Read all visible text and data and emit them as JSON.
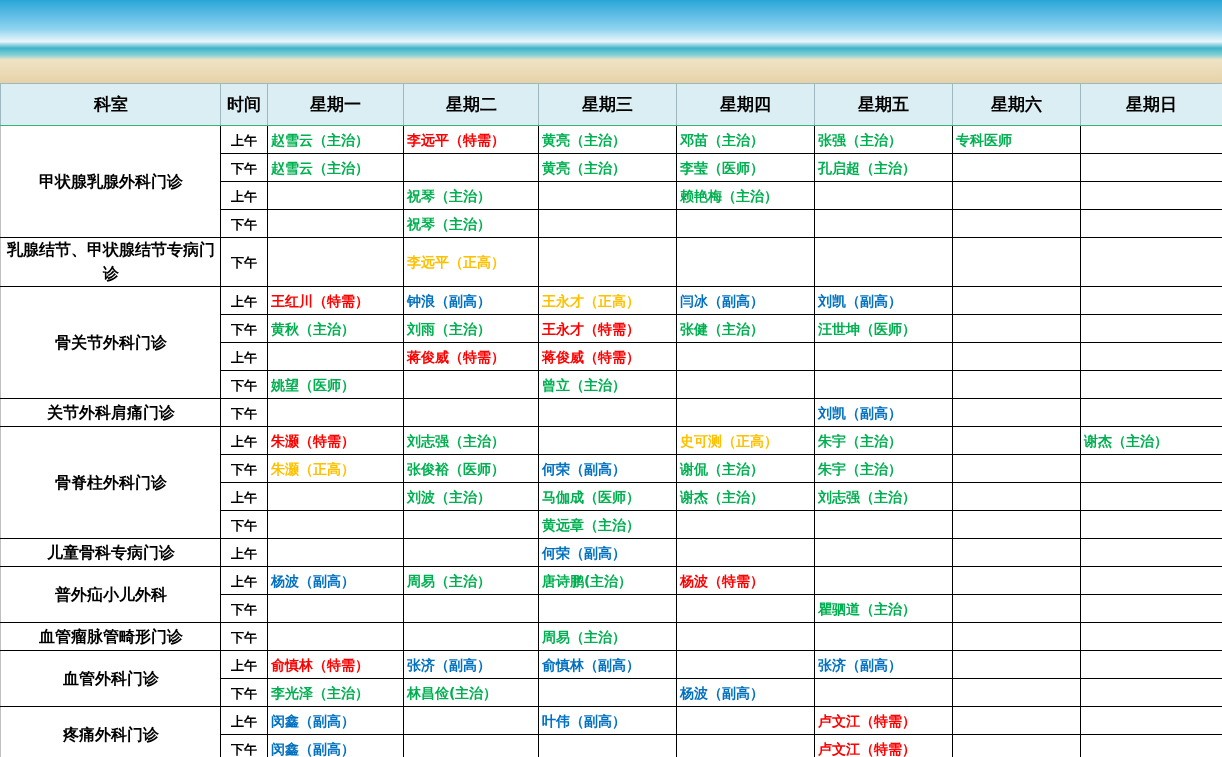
{
  "columns": [
    "科室",
    "时间",
    "星期一",
    "星期二",
    "星期三",
    "星期四",
    "星期五",
    "星期六",
    "星期日"
  ],
  "departments": [
    {
      "name": "甲状腺乳腺外科门诊",
      "slots": [
        {
          "time": "上午",
          "cells": [
            {
              "text": "赵雪云（主治）",
              "color": "#00b050"
            },
            {
              "text": "李远平（特需）",
              "color": "#ff0000"
            },
            {
              "text": "黄亮（主治）",
              "color": "#00b050"
            },
            {
              "text": "邓苗（主治）",
              "color": "#00b050"
            },
            {
              "text": "张强（主治）",
              "color": "#00b050"
            },
            {
              "text": "专科医师",
              "color": "#00b050"
            },
            null
          ]
        },
        {
          "time": "下午",
          "cells": [
            {
              "text": "赵雪云（主治）",
              "color": "#00b050"
            },
            null,
            {
              "text": "黄亮（主治）",
              "color": "#00b050"
            },
            {
              "text": "李莹（医师）",
              "color": "#00b050"
            },
            {
              "text": "孔启超（主治）",
              "color": "#00b050"
            },
            null,
            null
          ]
        },
        {
          "time": "上午",
          "cells": [
            null,
            {
              "text": "祝琴（主治）",
              "color": "#00b050"
            },
            null,
            {
              "text": "赖艳梅（主治）",
              "color": "#00b050"
            },
            null,
            null,
            null
          ]
        },
        {
          "time": "下午",
          "cells": [
            null,
            {
              "text": "祝琴（主治）",
              "color": "#00b050"
            },
            null,
            null,
            null,
            null,
            null
          ]
        }
      ]
    },
    {
      "name": "乳腺结节、甲状腺结节专病门诊",
      "slots": [
        {
          "time": "下午",
          "cells": [
            null,
            {
              "text": "李远平（正高）",
              "color": "#ffc000"
            },
            null,
            null,
            null,
            null,
            null
          ]
        }
      ]
    },
    {
      "name": "骨关节外科门诊",
      "slots": [
        {
          "time": "上午",
          "cells": [
            {
              "text": "王红川（特需）",
              "color": "#ff0000"
            },
            {
              "text": "钟浪（副高）",
              "color": "#0070c0"
            },
            {
              "text": "王永才（正高）",
              "color": "#ffc000"
            },
            {
              "text": "闫冰（副高）",
              "color": "#0070c0"
            },
            {
              "text": "刘凯（副高）",
              "color": "#0070c0"
            },
            null,
            null
          ]
        },
        {
          "time": "下午",
          "cells": [
            {
              "text": "黄秋（主治）",
              "color": "#00b050"
            },
            {
              "text": "刘雨（主治）",
              "color": "#00b050"
            },
            {
              "text": "王永才（特需）",
              "color": "#ff0000"
            },
            {
              "text": "张健（主治）",
              "color": "#00b050"
            },
            {
              "text": "汪世坤（医师）",
              "color": "#00b050"
            },
            null,
            null
          ]
        },
        {
          "time": "上午",
          "cells": [
            null,
            {
              "text": "蒋俊威（特需）",
              "color": "#ff0000"
            },
            {
              "text": "蒋俊威（特需）",
              "color": "#ff0000"
            },
            null,
            null,
            null,
            null
          ]
        },
        {
          "time": "下午",
          "cells": [
            {
              "text": "姚望（医师）",
              "color": "#00b050"
            },
            null,
            {
              "text": "曾立（主治）",
              "color": "#00b050"
            },
            null,
            null,
            null,
            null
          ]
        }
      ]
    },
    {
      "name": "关节外科肩痛门诊",
      "slots": [
        {
          "time": "下午",
          "cells": [
            null,
            null,
            null,
            null,
            {
              "text": "刘凯（副高）",
              "color": "#0070c0"
            },
            null,
            null
          ]
        }
      ]
    },
    {
      "name": "骨脊柱外科门诊",
      "slots": [
        {
          "time": "上午",
          "cells": [
            {
              "text": "朱灏（特需）",
              "color": "#ff0000"
            },
            {
              "text": "刘志强（主治）",
              "color": "#00b050"
            },
            null,
            {
              "text": "史可测（正高）",
              "color": "#ffc000"
            },
            {
              "text": "朱宇（主治）",
              "color": "#00b050"
            },
            null,
            {
              "text": "谢杰（主治）",
              "color": "#00b050"
            }
          ]
        },
        {
          "time": "下午",
          "cells": [
            {
              "text": "朱灏（正高）",
              "color": "#ffc000"
            },
            {
              "text": "张俊裕（医师）",
              "color": "#00b050"
            },
            {
              "text": "何荣（副高）",
              "color": "#0070c0"
            },
            {
              "text": "谢侃（主治）",
              "color": "#00b050"
            },
            {
              "text": "朱宇（主治）",
              "color": "#00b050"
            },
            null,
            null
          ]
        },
        {
          "time": "上午",
          "cells": [
            null,
            {
              "text": "刘波（主治）",
              "color": "#00b050"
            },
            {
              "text": "马伽成（医师）",
              "color": "#00b050"
            },
            {
              "text": "谢杰（主治）",
              "color": "#00b050"
            },
            {
              "text": "刘志强（主治）",
              "color": "#00b050"
            },
            null,
            null
          ]
        },
        {
          "time": "下午",
          "cells": [
            null,
            null,
            {
              "text": "黄远章（主治）",
              "color": "#00b050"
            },
            null,
            null,
            null,
            null
          ]
        }
      ]
    },
    {
      "name": "儿童骨科专病门诊",
      "slots": [
        {
          "time": "上午",
          "cells": [
            null,
            null,
            {
              "text": "何荣（副高）",
              "color": "#0070c0"
            },
            null,
            null,
            null,
            null
          ]
        }
      ]
    },
    {
      "name": "普外疝小儿外科",
      "slots": [
        {
          "time": "上午",
          "cells": [
            {
              "text": "杨波（副高）",
              "color": "#0070c0"
            },
            {
              "text": "周易（主治）",
              "color": "#00b050"
            },
            {
              "text": "唐诗鹏(主治）",
              "color": "#00b050"
            },
            {
              "text": "杨波（特需）",
              "color": "#ff0000"
            },
            null,
            null,
            null
          ]
        },
        {
          "time": "下午",
          "cells": [
            null,
            null,
            null,
            null,
            {
              "text": "瞿驷道（主治）",
              "color": "#00b050"
            },
            null,
            null
          ]
        }
      ]
    },
    {
      "name": "血管瘤脉管畸形门诊",
      "slots": [
        {
          "time": "下午",
          "cells": [
            null,
            null,
            {
              "text": "周易（主治）",
              "color": "#00b050"
            },
            null,
            null,
            null,
            null
          ]
        }
      ]
    },
    {
      "name": "血管外科门诊",
      "slots": [
        {
          "time": "上午",
          "cells": [
            {
              "text": "俞慎林（特需）",
              "color": "#ff0000"
            },
            {
              "text": "张济（副高）",
              "color": "#0070c0"
            },
            {
              "text": "俞慎林（副高）",
              "color": "#0070c0"
            },
            null,
            {
              "text": "张济（副高）",
              "color": "#0070c0"
            },
            null,
            null
          ]
        },
        {
          "time": "下午",
          "cells": [
            {
              "text": "李光泽（主治）",
              "color": "#00b050"
            },
            {
              "text": "林昌俭(主治）",
              "color": "#00b050"
            },
            null,
            {
              "text": "杨波（副高）",
              "color": "#0070c0"
            },
            null,
            null,
            null
          ]
        }
      ]
    },
    {
      "name": "疼痛外科门诊",
      "slots": [
        {
          "time": "上午",
          "cells": [
            {
              "text": "闵鑫（副高）",
              "color": "#0070c0"
            },
            null,
            {
              "text": "叶伟（副高）",
              "color": "#0070c0"
            },
            null,
            {
              "text": "卢文江（特需）",
              "color": "#ff0000"
            },
            null,
            null
          ]
        },
        {
          "time": "下午",
          "cells": [
            {
              "text": "闵鑫（副高）",
              "color": "#0070c0"
            },
            null,
            null,
            null,
            {
              "text": "卢文江（特需）",
              "color": "#ff0000"
            },
            null,
            null
          ]
        }
      ]
    }
  ]
}
